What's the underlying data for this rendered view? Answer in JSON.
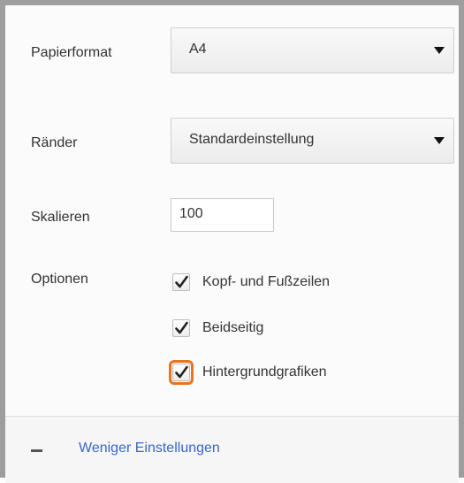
{
  "settings": {
    "paper_format": {
      "label": "Papierformat",
      "value": "A4"
    },
    "margins": {
      "label": "Ränder",
      "value": "Standardeinstellung"
    },
    "scale": {
      "label": "Skalieren",
      "value": "100"
    },
    "options": {
      "label": "Optionen",
      "items": [
        {
          "label": "Kopf- und Fußzeilen",
          "checked": true
        },
        {
          "label": "Beidseitig",
          "checked": true
        },
        {
          "label": "Hintergrundgrafiken",
          "checked": true,
          "highlighted": true
        }
      ]
    }
  },
  "footer": {
    "toggle_label": "Weniger Einstellungen",
    "icon": "minus-icon"
  },
  "colors": {
    "highlight": "#e8741f",
    "link": "#3a66c4"
  }
}
